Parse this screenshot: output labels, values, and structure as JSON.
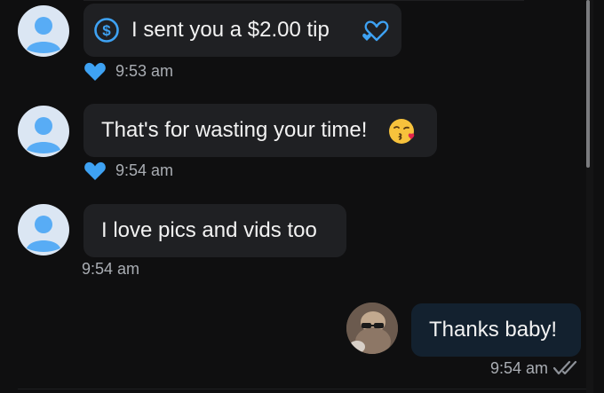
{
  "messages": [
    {
      "sender": "creator",
      "text": "I sent you a $2.00 tip",
      "time": "9:53 am",
      "liked": true,
      "type": "tip"
    },
    {
      "sender": "creator",
      "text": "That's for wasting your time!",
      "time": "9:54 am",
      "liked": true,
      "emoji": "kissing-face-emoji"
    },
    {
      "sender": "creator",
      "text": "I love pics and vids too",
      "time": "9:54 am",
      "liked": false
    },
    {
      "sender": "me",
      "text": "Thanks baby!",
      "time": "9:54 am",
      "read": true
    }
  ],
  "colors": {
    "accent": "#3ea2f3",
    "bubble_incoming": "#1f2023",
    "bubble_outgoing": "#13212f",
    "meta_text": "#a9adb3"
  },
  "icons": {
    "tip": "dollar-circle-icon",
    "tip_decoration": "hearts-icon",
    "like": "heart-icon",
    "read_receipt": "double-check-icon",
    "default_avatar": "user-avatar-icon"
  }
}
